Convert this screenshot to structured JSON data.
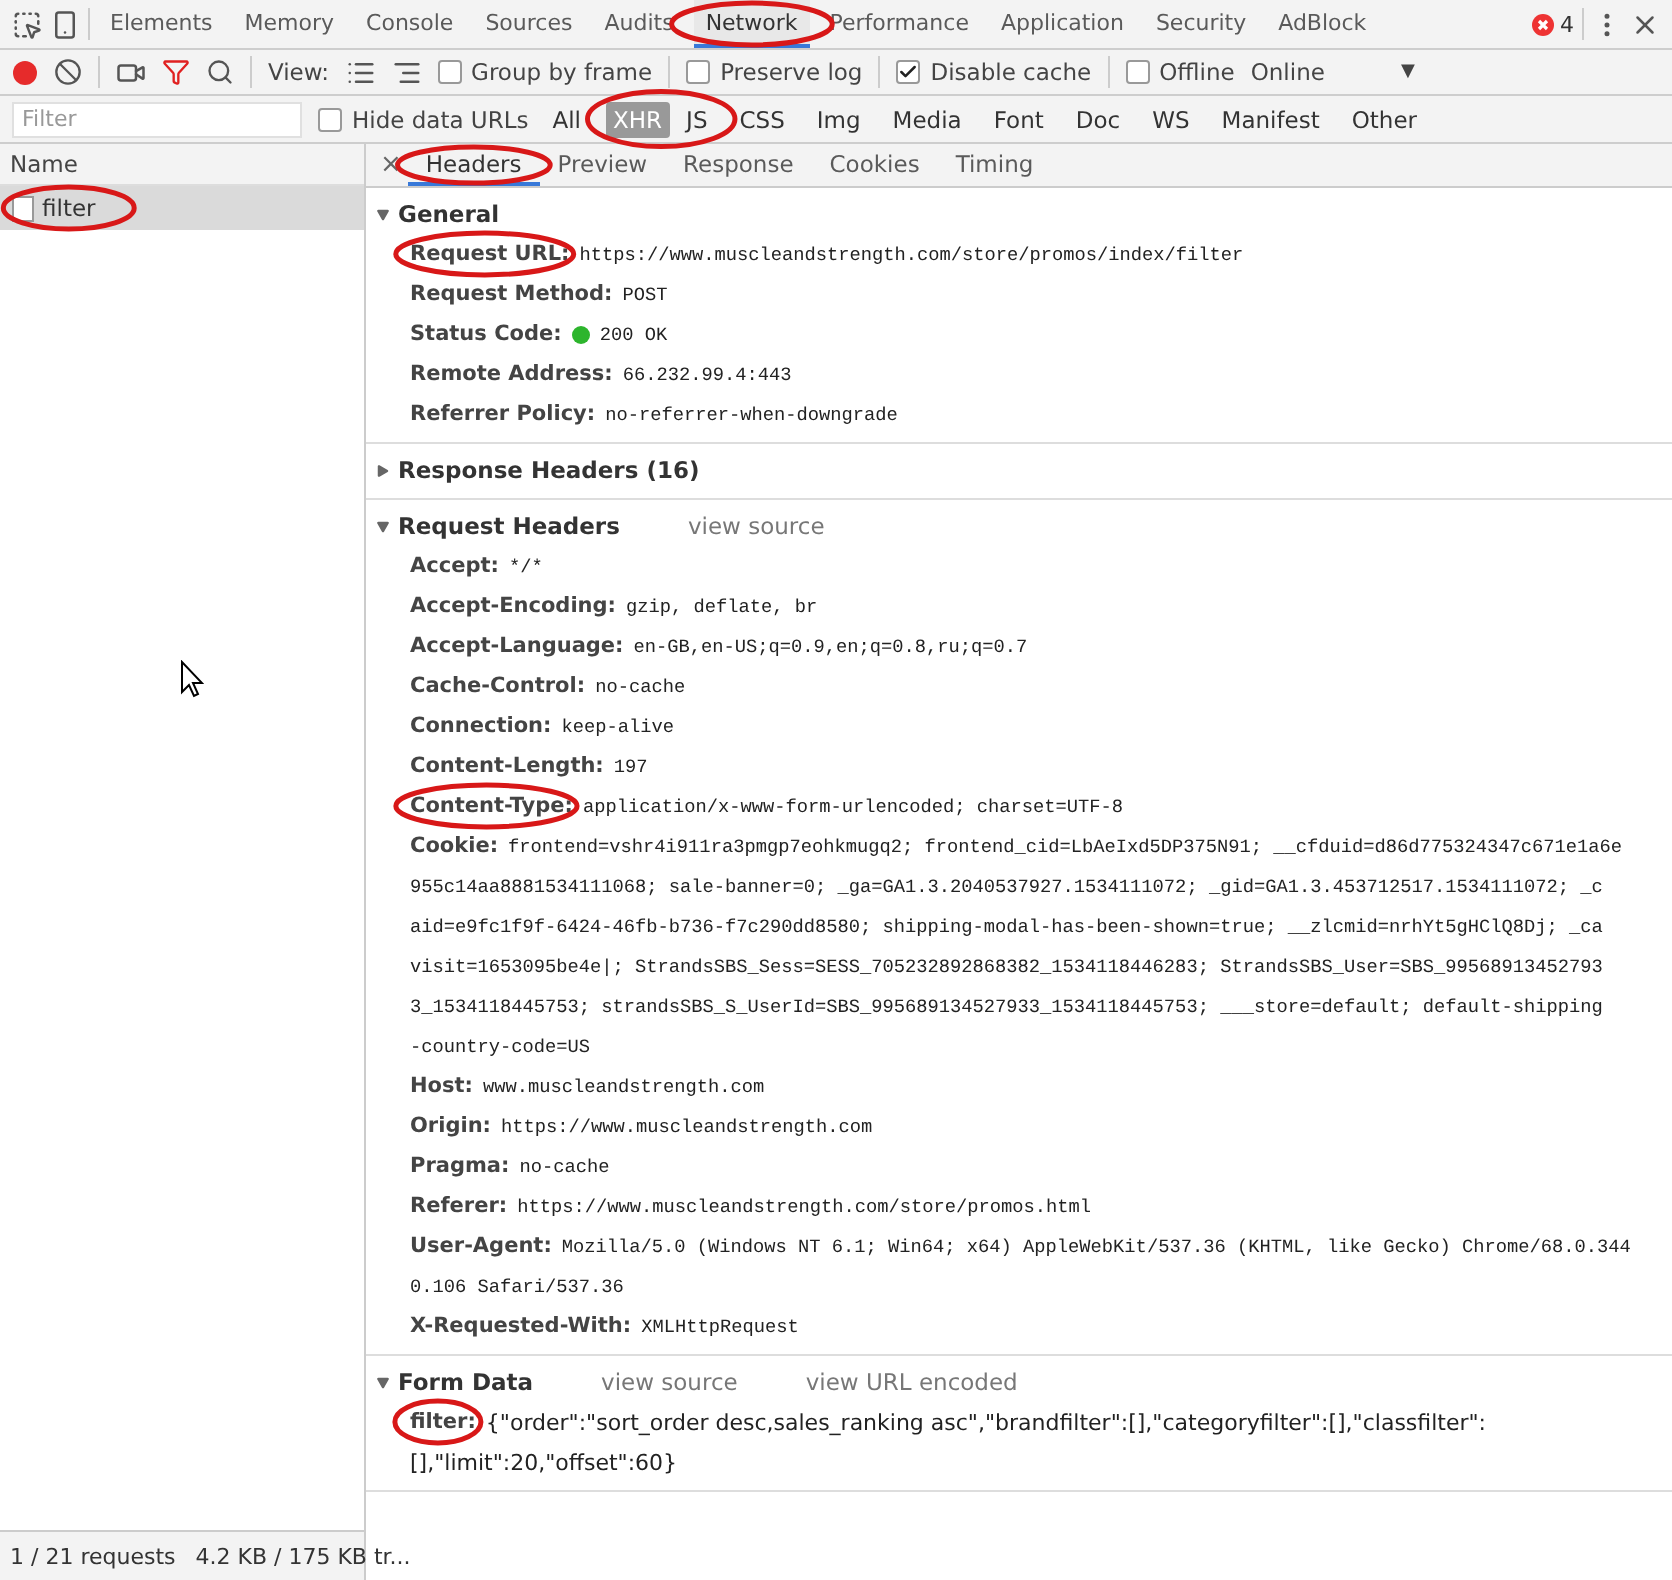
{
  "main_tabs": [
    {
      "label": "Elements",
      "selected": false
    },
    {
      "label": "Memory",
      "selected": false
    },
    {
      "label": "Console",
      "selected": false
    },
    {
      "label": "Sources",
      "selected": false
    },
    {
      "label": "Audits",
      "selected": false
    },
    {
      "label": "Network",
      "selected": true,
      "circled": true
    },
    {
      "label": "Performance",
      "selected": false
    },
    {
      "label": "Application",
      "selected": false
    },
    {
      "label": "Security",
      "selected": false
    },
    {
      "label": "AdBlock",
      "selected": false
    }
  ],
  "error_count": "4",
  "toolbar": {
    "recording": true,
    "filter_on": true,
    "view_label": "View:",
    "options": [
      {
        "label": "Group by frame",
        "checked": false
      },
      {
        "label": "Preserve log",
        "checked": false
      },
      {
        "label": "Disable cache",
        "checked": true
      },
      {
        "label": "Offline",
        "checked": false
      }
    ],
    "throttle": "Online",
    "throttle_arrow": "▼"
  },
  "filter_bar": {
    "placeholder": "Filter",
    "hide_data_urls": {
      "label": "Hide data URLs",
      "checked": false
    },
    "types": [
      {
        "label": "All",
        "selected": false
      },
      {
        "label": "XHR",
        "selected": true,
        "circled": true
      },
      {
        "label": "JS",
        "selected": false,
        "circled": true
      },
      {
        "label": "CSS",
        "selected": false
      },
      {
        "label": "Img",
        "selected": false
      },
      {
        "label": "Media",
        "selected": false
      },
      {
        "label": "Font",
        "selected": false
      },
      {
        "label": "Doc",
        "selected": false
      },
      {
        "label": "WS",
        "selected": false
      },
      {
        "label": "Manifest",
        "selected": false
      },
      {
        "label": "Other",
        "selected": false
      }
    ]
  },
  "requests": {
    "column": "Name",
    "rows": [
      {
        "name": "filter",
        "selected": true,
        "circled": true
      }
    ],
    "summary": "1 / 21 requests",
    "transfer": "4.2 KB / 175 KB tr..."
  },
  "details": {
    "close": "×",
    "tabs": [
      {
        "label": "Headers",
        "selected": true,
        "circled": true
      },
      {
        "label": "Preview",
        "selected": false
      },
      {
        "label": "Response",
        "selected": false
      },
      {
        "label": "Cookies",
        "selected": false
      },
      {
        "label": "Timing",
        "selected": false
      }
    ],
    "sections": [
      {
        "title": "General",
        "expanded": true,
        "rows": [
          {
            "name": "Request URL:",
            "value": "https://www.muscleandstrength.com/store/promos/index/filter",
            "circled": true
          },
          {
            "name": "Request Method:",
            "value": "POST"
          },
          {
            "name": "Status Code:",
            "value": "200 OK",
            "color": "#2db52d"
          },
          {
            "name": "Remote Address:",
            "value": "66.232.99.4:443"
          },
          {
            "name": "Referrer Policy:",
            "value": "no-referrer-when-downgrade"
          }
        ]
      },
      {
        "title": "Response Headers (16)",
        "expanded": false
      },
      {
        "title": "Request Headers",
        "expanded": true,
        "links": [
          "view source"
        ],
        "rows": [
          {
            "name": "Accept:",
            "value": "*/*"
          },
          {
            "name": "Accept-Encoding:",
            "value": "gzip, deflate, br"
          },
          {
            "name": "Accept-Language:",
            "value": "en-GB,en-US;q=0.9,en;q=0.8,ru;q=0.7"
          },
          {
            "name": "Cache-Control:",
            "value": "no-cache"
          },
          {
            "name": "Connection:",
            "value": "keep-alive"
          },
          {
            "name": "Content-Length:",
            "value": "197"
          },
          {
            "name": "Content-Type:",
            "value": "application/x-www-form-urlencoded; charset=UTF-8",
            "circled": true
          },
          {
            "name": "Cookie:",
            "value": "frontend=vshr4i911ra3pmgp7eohkmugq2; frontend_cid=LbAeIxd5DP375N91; __cfduid=d86d775324347c671e1a6e",
            "continued": [
              "955c14aa8881534111068; sale-banner=0; _ga=GA1.3.2040537927.1534111072; _gid=GA1.3.453712517.1534111072; _c",
              "aid=e9fc1f9f-6424-46fb-b736-f7c290dd8580; shipping-modal-has-been-shown=true; __zlcmid=nrhYt5gHClQ8Dj; _ca",
              "visit=1653095be4e|; StrandsSBS_Sess=SESS_705232892868382_1534118446283; StrandsSBS_User=SBS_99568913452793",
              "3_1534118445753; strandsSBS_S_UserId=SBS_995689134527933_1534118445753; ___store=default; default-shipping",
              "-country-code=US"
            ]
          },
          {
            "name": "Host:",
            "value": "www.muscleandstrength.com"
          },
          {
            "name": "Origin:",
            "value": "https://www.muscleandstrength.com"
          },
          {
            "name": "Pragma:",
            "value": "no-cache"
          },
          {
            "name": "Referer:",
            "value": "https://www.muscleandstrength.com/store/promos.html"
          },
          {
            "name": "User-Agent:",
            "value": "Mozilla/5.0 (Windows NT 6.1; Win64; x64) AppleWebKit/537.36 (KHTML, like Gecko) Chrome/68.0.344",
            "continued": [
              "0.106 Safari/537.36"
            ]
          },
          {
            "name": "X-Requested-With:",
            "value": "XMLHttpRequest"
          }
        ]
      },
      {
        "title": "Form Data",
        "expanded": true,
        "links": [
          "view source",
          "view URL encoded"
        ],
        "plain": true,
        "rows": [
          {
            "name": "filter:",
            "value": "{\"order\":\"sort_order desc,sales_ranking asc\",\"brandfilter\":[],\"categoryfilter\":[],\"classfilter\":",
            "continued": [
              "[],\"limit\":20,\"offset\":60}"
            ],
            "circled": true
          }
        ]
      }
    ]
  }
}
